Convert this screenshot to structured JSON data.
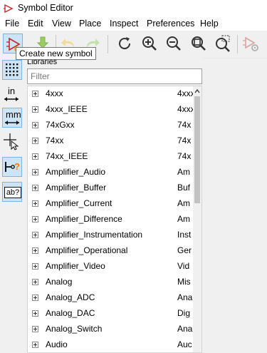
{
  "window": {
    "title": "Symbol Editor"
  },
  "menu": [
    "File",
    "Edit",
    "View",
    "Place",
    "Inspect",
    "Preferences",
    "Help"
  ],
  "toolbar": {
    "buttons": [
      "new-symbol",
      "save",
      "undo",
      "redo",
      "refresh",
      "zoom-in",
      "zoom-out",
      "zoom-fit",
      "zoom-selection",
      "symbol-properties"
    ],
    "tooltip": "Create new symbol"
  },
  "left_tools": {
    "units_inch": "in",
    "units_mm": "mm",
    "text_tool": "ab?"
  },
  "libraries": {
    "header": "Libraries",
    "filter_placeholder": "Filter",
    "rows": [
      {
        "name": "4xxx",
        "desc": "4xxx"
      },
      {
        "name": "4xxx_IEEE",
        "desc": "4xxx"
      },
      {
        "name": "74xGxx",
        "desc": "74x"
      },
      {
        "name": "74xx",
        "desc": "74x"
      },
      {
        "name": "74xx_IEEE",
        "desc": "74x"
      },
      {
        "name": "Amplifier_Audio",
        "desc": "Am"
      },
      {
        "name": "Amplifier_Buffer",
        "desc": "Buf"
      },
      {
        "name": "Amplifier_Current",
        "desc": "Am"
      },
      {
        "name": "Amplifier_Difference",
        "desc": "Am"
      },
      {
        "name": "Amplifier_Instrumentation",
        "desc": "Inst"
      },
      {
        "name": "Amplifier_Operational",
        "desc": "Ger"
      },
      {
        "name": "Amplifier_Video",
        "desc": "Vid"
      },
      {
        "name": "Analog",
        "desc": "Mis"
      },
      {
        "name": "Analog_ADC",
        "desc": "Ana"
      },
      {
        "name": "Analog_DAC",
        "desc": "Dig"
      },
      {
        "name": "Analog_Switch",
        "desc": "Ana"
      },
      {
        "name": "Audio",
        "desc": "Auc"
      }
    ]
  }
}
